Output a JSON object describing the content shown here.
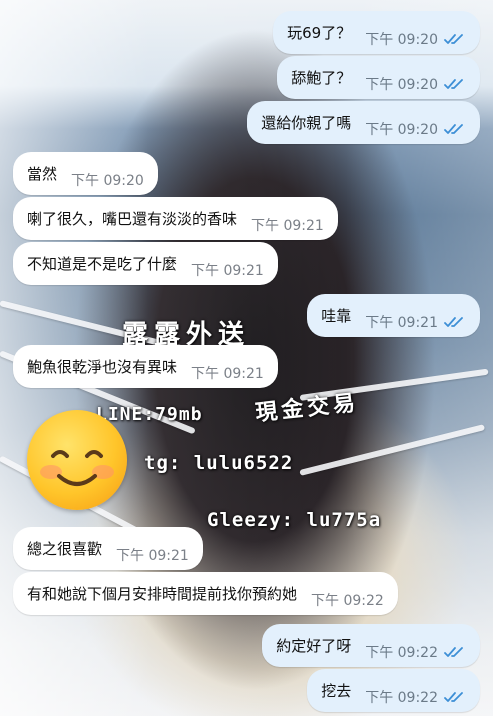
{
  "messages": [
    {
      "dir": "out",
      "text": "玩69了？",
      "time": "下午 09:20",
      "read": true
    },
    {
      "dir": "out",
      "text": "舔鮑了？",
      "time": "下午 09:20",
      "read": true
    },
    {
      "dir": "out",
      "text": "還給你親了嗎",
      "time": "下午 09:20",
      "read": true
    },
    {
      "dir": "in",
      "text": "當然",
      "time": "下午 09:20"
    },
    {
      "dir": "in",
      "text": "喇了很久，嘴巴還有淡淡的香味",
      "time": "下午 09:21"
    },
    {
      "dir": "in",
      "text": "不知道是不是吃了什麼",
      "time": "下午 09:21"
    },
    {
      "dir": "out",
      "text": "哇靠",
      "time": "下午 09:21",
      "read": true
    },
    {
      "dir": "in",
      "text": "鮑魚很乾淨也沒有異味",
      "time": "下午 09:21"
    },
    {
      "dir": "in",
      "text": "總之很喜歡",
      "time": "下午 09:21"
    },
    {
      "dir": "in",
      "text": "有和她說下個月安排時間提前找你預約她",
      "time": "下午 09:22"
    },
    {
      "dir": "out",
      "text": "約定好了呀",
      "time": "下午 09:22",
      "read": true
    },
    {
      "dir": "out",
      "text": "挖去",
      "time": "下午 09:22",
      "read": true
    }
  ],
  "watermarks": {
    "brand": "露露外送",
    "tagline": "現金交易",
    "line": "LINE:79mb",
    "tg": "tg: lulu6522",
    "gleezy": "Gleezy: lu775a"
  },
  "colors": {
    "outgoing": "#e3f0fc",
    "incoming": "#ffffff",
    "tick": "#3d8fd6"
  },
  "sticker": "smiling-face-emoji"
}
